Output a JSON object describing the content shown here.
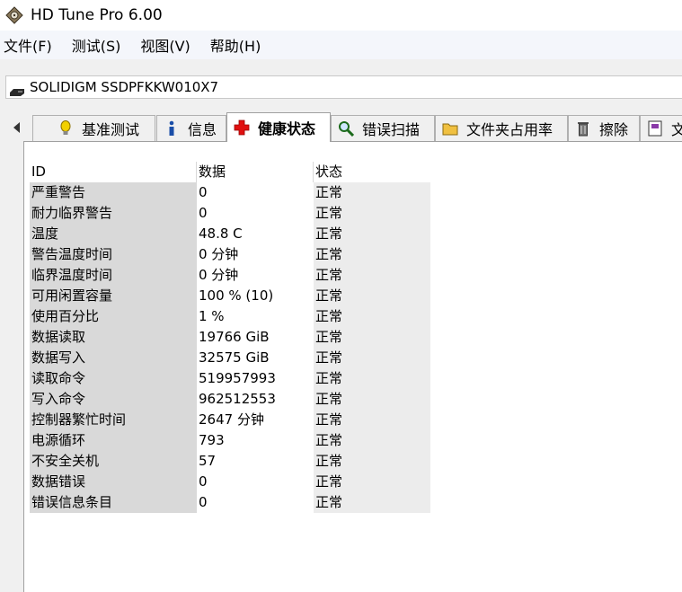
{
  "window": {
    "title": "HD Tune Pro 6.00"
  },
  "menu": [
    "文件(F)",
    "测试(S)",
    "视图(V)",
    "帮助(H)"
  ],
  "drive": {
    "name": "SOLIDIGM SSDPFKKW010X7"
  },
  "tabs": [
    {
      "label": "基准测试",
      "icon": "lightbulb-icon"
    },
    {
      "label": "信息",
      "icon": "info-icon"
    },
    {
      "label": "健康状态",
      "icon": "red-cross-icon",
      "active": true
    },
    {
      "label": "错误扫描",
      "icon": "magnifier-icon"
    },
    {
      "label": "文件夹占用率",
      "icon": "folder-icon"
    },
    {
      "label": "擦除",
      "icon": "trash-icon"
    },
    {
      "label": "文",
      "icon": "document-icon"
    }
  ],
  "health": {
    "columns": [
      "ID",
      "数据",
      "状态"
    ],
    "rows": [
      {
        "id": "严重警告",
        "data": "0",
        "status": "正常"
      },
      {
        "id": "耐力临界警告",
        "data": "0",
        "status": "正常"
      },
      {
        "id": "温度",
        "data": "48.8 C",
        "status": "正常"
      },
      {
        "id": "警告温度时间",
        "data": "0 分钟",
        "status": "正常"
      },
      {
        "id": "临界温度时间",
        "data": "0 分钟",
        "status": "正常"
      },
      {
        "id": "可用闲置容量",
        "data": "100 % (10)",
        "status": "正常"
      },
      {
        "id": "使用百分比",
        "data": "1 %",
        "status": "正常"
      },
      {
        "id": "数据读取",
        "data": "19766 GiB",
        "status": "正常"
      },
      {
        "id": "数据写入",
        "data": "32575 GiB",
        "status": "正常"
      },
      {
        "id": "读取命令",
        "data": "519957993",
        "status": "正常"
      },
      {
        "id": "写入命令",
        "data": "962512553",
        "status": "正常"
      },
      {
        "id": "控制器繁忙时间",
        "data": "2647 分钟",
        "status": "正常"
      },
      {
        "id": "电源循环",
        "data": "793",
        "status": "正常"
      },
      {
        "id": "不安全关机",
        "data": "57",
        "status": "正常"
      },
      {
        "id": "数据错误",
        "data": "0",
        "status": "正常"
      },
      {
        "id": "错误信息条目",
        "data": "0",
        "status": "正常"
      }
    ]
  },
  "colors": {
    "id_column_bg": "#d9d9d9",
    "status_column_bg": "#ececec",
    "active_tab_bg": "#ffffff"
  }
}
